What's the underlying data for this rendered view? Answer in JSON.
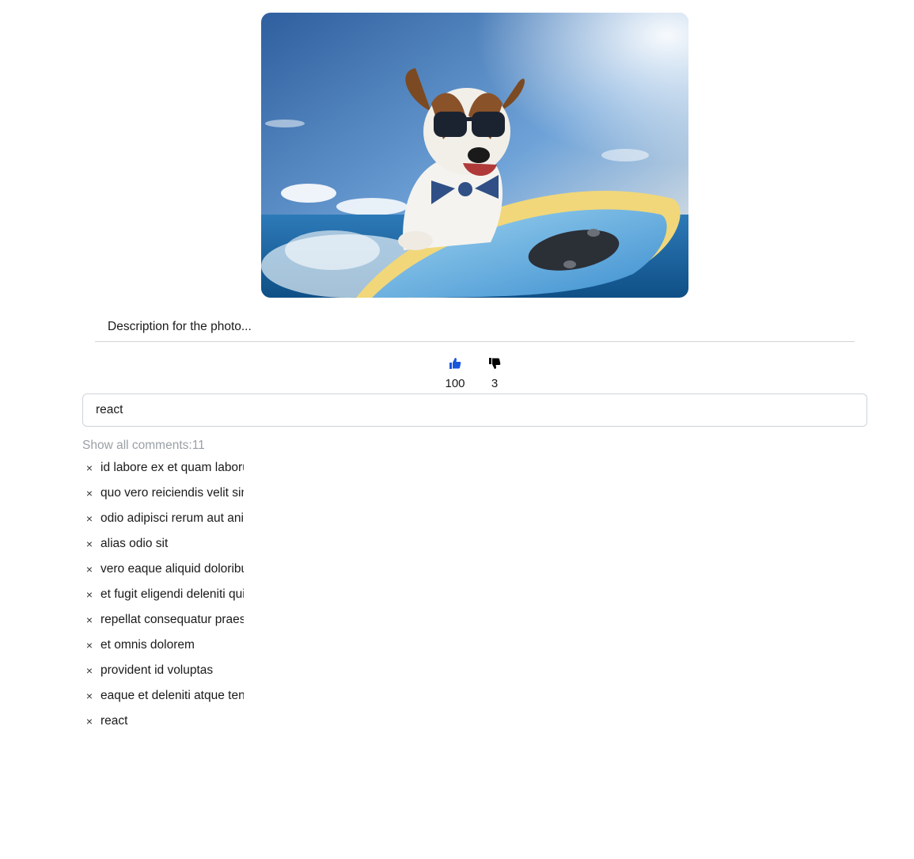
{
  "post": {
    "photo_alt": "Dog with sunglasses surfing",
    "description": "Description for the photo..."
  },
  "reactions": {
    "likes": "100",
    "dislikes": "3",
    "like_icon": "thumbs-up-icon",
    "dislike_icon": "thumbs-down-icon",
    "like_color": "#1a56db",
    "dislike_color": "#000000"
  },
  "comment_input": {
    "value": "react"
  },
  "comments_section": {
    "show_all_label": "Show all comments:11",
    "remove_glyph": "×",
    "items": [
      {
        "text": "id labore ex et quam laborum"
      },
      {
        "text": "quo vero reiciendis velit similique"
      },
      {
        "text": "odio adipisci rerum aut animi"
      },
      {
        "text": "alias odio sit"
      },
      {
        "text": "vero eaque aliquid doloribus"
      },
      {
        "text": "et fugit eligendi deleniti quidem"
      },
      {
        "text": "repellat consequatur praesentium"
      },
      {
        "text": "et omnis dolorem"
      },
      {
        "text": "provident id voluptas"
      },
      {
        "text": "eaque et deleniti atque tenetur"
      },
      {
        "text": "react"
      }
    ]
  }
}
